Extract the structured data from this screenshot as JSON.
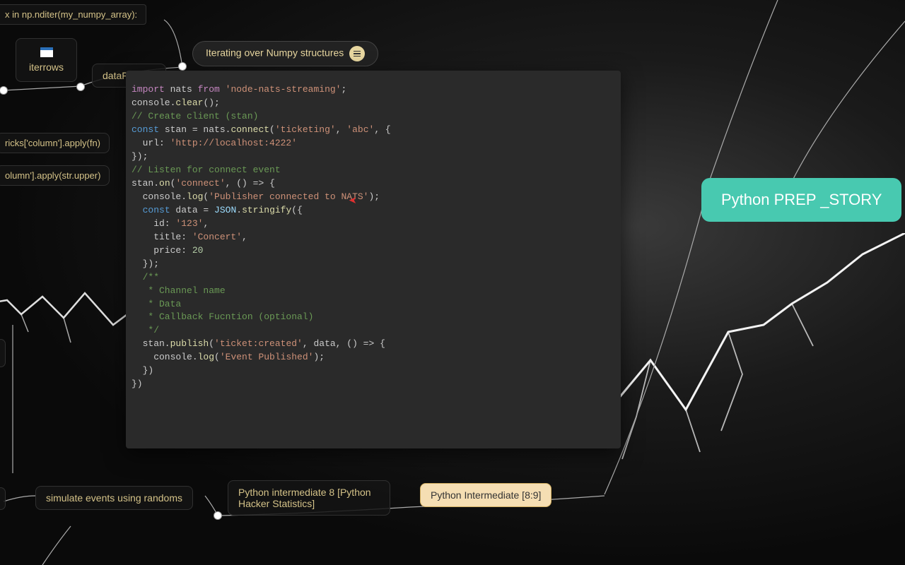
{
  "nodes": {
    "nditer": "x in np.nditer(my_numpy_array):",
    "iterrows": "iterrows",
    "dataframes": "dataFrames",
    "apply_fn": "ricks['column'].apply(fn)",
    "apply_upper": "olumn'].apply(str.upper)",
    "iterating": "Iterating over Numpy structures",
    "simulate": "simulate events using randoms",
    "intermediate8": "Python intermediate 8 [Python Hacker Statistics]",
    "intermediate89": "Python Intermediate [8:9]",
    "prep_story": "Python PREP _STORY"
  },
  "code": [
    {
      "t": "import",
      "c": "kw"
    },
    {
      "t": " nats ",
      "c": ""
    },
    {
      "t": "from",
      "c": "kw"
    },
    {
      "t": " ",
      "c": ""
    },
    {
      "t": "'node-nats-streaming'",
      "c": "str"
    },
    {
      "t": ";",
      "c": ""
    },
    {
      "br": 1
    },
    {
      "br": 1
    },
    {
      "t": "console.",
      "c": ""
    },
    {
      "t": "clear",
      "c": "fn"
    },
    {
      "t": "();",
      "c": ""
    },
    {
      "br": 1
    },
    {
      "br": 1
    },
    {
      "t": "// Create client (stan)",
      "c": "com"
    },
    {
      "br": 1
    },
    {
      "t": "const",
      "c": "key2"
    },
    {
      "t": " stan = nats.",
      "c": ""
    },
    {
      "t": "connect",
      "c": "fn"
    },
    {
      "t": "(",
      "c": ""
    },
    {
      "t": "'ticketing'",
      "c": "str"
    },
    {
      "t": ", ",
      "c": ""
    },
    {
      "t": "'abc'",
      "c": "str"
    },
    {
      "t": ", {",
      "c": ""
    },
    {
      "br": 1
    },
    {
      "t": "  url: ",
      "c": ""
    },
    {
      "t": "'http://localhost:4222'",
      "c": "str"
    },
    {
      "br": 1
    },
    {
      "t": "});",
      "c": ""
    },
    {
      "br": 1
    },
    {
      "br": 1
    },
    {
      "t": "// Listen for connect event",
      "c": "com"
    },
    {
      "br": 1
    },
    {
      "t": "stan.",
      "c": ""
    },
    {
      "t": "on",
      "c": "fn"
    },
    {
      "t": "(",
      "c": ""
    },
    {
      "t": "'connect'",
      "c": "str"
    },
    {
      "t": ", () => {",
      "c": ""
    },
    {
      "br": 1
    },
    {
      "t": "  console.",
      "c": ""
    },
    {
      "t": "log",
      "c": "fn"
    },
    {
      "t": "(",
      "c": ""
    },
    {
      "t": "'Publisher connected to NATS'",
      "c": "str"
    },
    {
      "t": ");",
      "c": ""
    },
    {
      "br": 1
    },
    {
      "br": 1
    },
    {
      "t": "  ",
      "c": ""
    },
    {
      "t": "const",
      "c": "key2"
    },
    {
      "t": " data = ",
      "c": ""
    },
    {
      "t": "JSON",
      "c": "var"
    },
    {
      "t": ".",
      "c": ""
    },
    {
      "t": "stringify",
      "c": "fn"
    },
    {
      "t": "({",
      "c": ""
    },
    {
      "br": 1
    },
    {
      "t": "    id: ",
      "c": ""
    },
    {
      "t": "'123'",
      "c": "str"
    },
    {
      "t": ",",
      "c": ""
    },
    {
      "br": 1
    },
    {
      "t": "    title: ",
      "c": ""
    },
    {
      "t": "'Concert'",
      "c": "str"
    },
    {
      "t": ",",
      "c": ""
    },
    {
      "br": 1
    },
    {
      "t": "    price: ",
      "c": ""
    },
    {
      "t": "20",
      "c": "num"
    },
    {
      "br": 1
    },
    {
      "t": "  });",
      "c": ""
    },
    {
      "br": 1
    },
    {
      "t": "  /**",
      "c": "com"
    },
    {
      "br": 1
    },
    {
      "t": "   * Channel name",
      "c": "com"
    },
    {
      "br": 1
    },
    {
      "t": "   * Data",
      "c": "com"
    },
    {
      "br": 1
    },
    {
      "t": "   * Callback Fucntion (optional)",
      "c": "com"
    },
    {
      "br": 1
    },
    {
      "t": "   */",
      "c": "com"
    },
    {
      "br": 1
    },
    {
      "t": "  stan.",
      "c": ""
    },
    {
      "t": "publish",
      "c": "fn"
    },
    {
      "t": "(",
      "c": ""
    },
    {
      "t": "'ticket:created'",
      "c": "str"
    },
    {
      "t": ", data, () => {",
      "c": ""
    },
    {
      "br": 1
    },
    {
      "t": "    console.",
      "c": ""
    },
    {
      "t": "log",
      "c": "fn"
    },
    {
      "t": "(",
      "c": ""
    },
    {
      "t": "'Event Published'",
      "c": "str"
    },
    {
      "t": ");",
      "c": ""
    },
    {
      "br": 1
    },
    {
      "t": "  })",
      "c": ""
    },
    {
      "br": 1
    },
    {
      "t": "})",
      "c": ""
    }
  ]
}
